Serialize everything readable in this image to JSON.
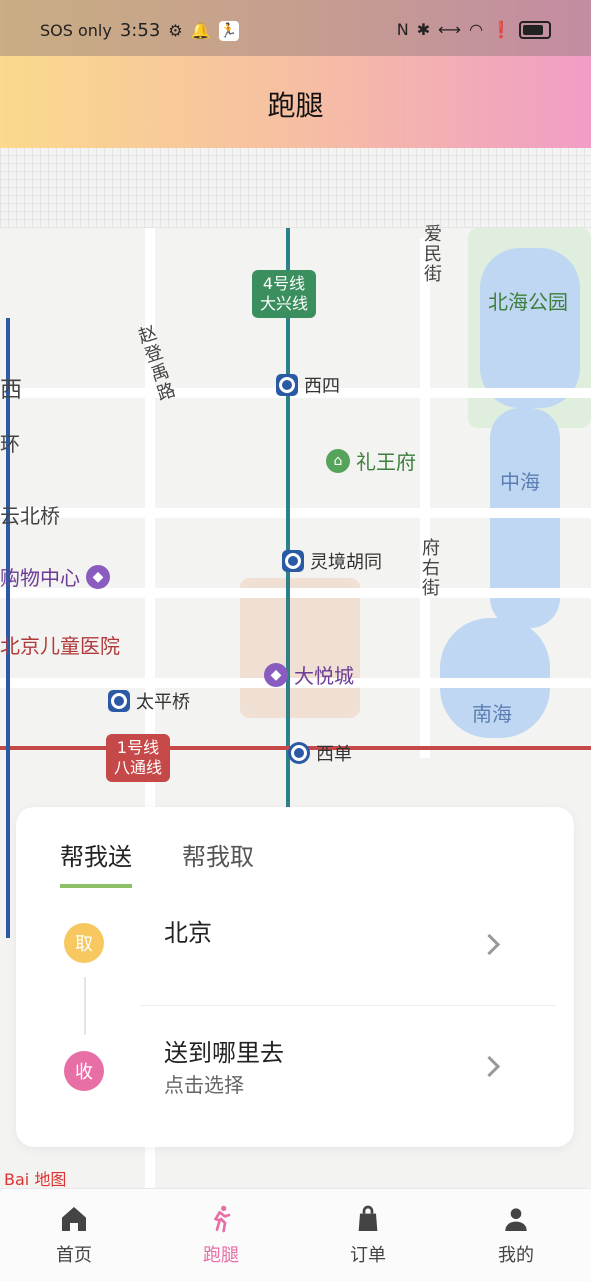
{
  "status_bar": {
    "carrier": "SOS only",
    "time": "3:53"
  },
  "header": {
    "title": "跑腿"
  },
  "map": {
    "labels": {
      "aiminjie": "爱民街",
      "beihai_park": "北海公园",
      "zhaodeng_road": "赵登禹路",
      "xisi": "西四",
      "liwangfu": "礼王府",
      "zhonghai": "中海",
      "guanbeiqiao_partial": "云北桥",
      "lingjing_hutong": "灵境胡同",
      "fuyoujie": "府右街",
      "shopping_center_partial": "购物中心",
      "children_hospital_partial": "北京儿童医院",
      "joy_city": "大悦城",
      "nanhai": "南海",
      "taipingqiao": "太平桥",
      "xidan": "西单",
      "left_edge_xi": "西",
      "left_edge_huan": "环"
    },
    "metro_badges": {
      "line4": "4号线\n大兴线",
      "line1": "1号线\n八通线"
    },
    "logo": "Bai 地图"
  },
  "delivery_card": {
    "tabs": [
      "帮我送",
      "帮我取"
    ],
    "pickup_circle": "取",
    "receive_circle": "收",
    "pickup_address": "北京",
    "dropoff_title": "送到哪里去",
    "dropoff_sub": "点击选择"
  },
  "bottom_nav": {
    "items": [
      {
        "label": "首页",
        "icon": "home-icon"
      },
      {
        "label": "跑腿",
        "icon": "runner-icon"
      },
      {
        "label": "订单",
        "icon": "bag-icon"
      },
      {
        "label": "我的",
        "icon": "user-icon"
      }
    ],
    "active_color": "#e86ea6"
  }
}
